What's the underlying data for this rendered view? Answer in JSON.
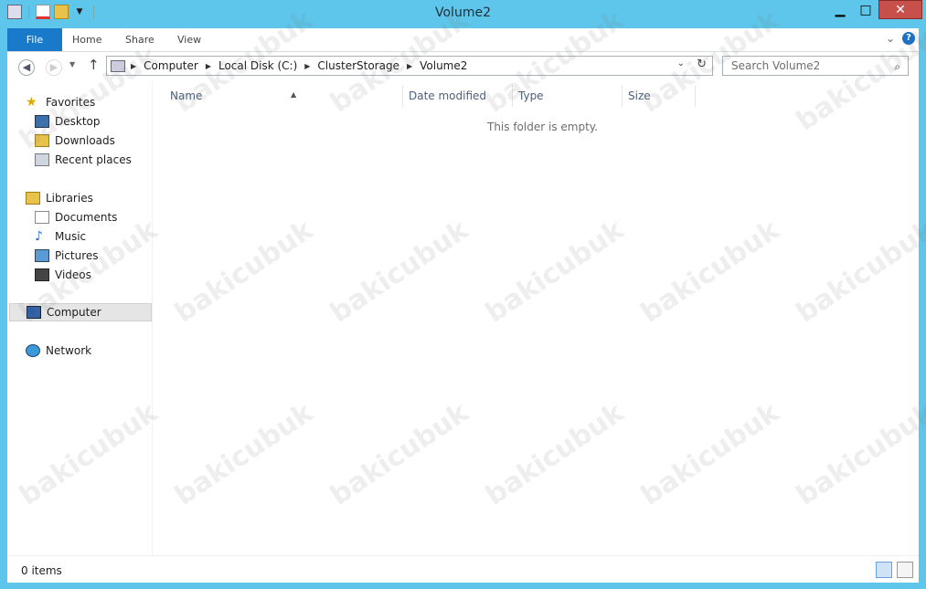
{
  "window": {
    "title": "Volume2",
    "close_glyph": "✕",
    "min_glyph": "▁",
    "max_glyph": "□"
  },
  "ribbon": {
    "tabs": [
      "File",
      "Home",
      "Share",
      "View"
    ],
    "help_glyph": "?",
    "expand_glyph": "⌄"
  },
  "address": {
    "crumbs": [
      "Computer",
      "Local Disk (C:)",
      "ClusterStorage",
      "Volume2"
    ],
    "search_placeholder": "Search Volume2"
  },
  "nav": {
    "favorites": "Favorites",
    "favorites_items": [
      "Desktop",
      "Downloads",
      "Recent places"
    ],
    "libraries": "Libraries",
    "libraries_items": [
      "Documents",
      "Music",
      "Pictures",
      "Videos"
    ],
    "computer": "Computer",
    "network": "Network"
  },
  "columns": [
    "Name",
    "Date modified",
    "Type",
    "Size"
  ],
  "empty_text": "This folder is empty.",
  "status": {
    "count": "0 items"
  },
  "watermark": "bakicubuk",
  "colors": {
    "accent": "#1979ca",
    "frame": "#5ec6ea",
    "close": "#c7504a"
  }
}
